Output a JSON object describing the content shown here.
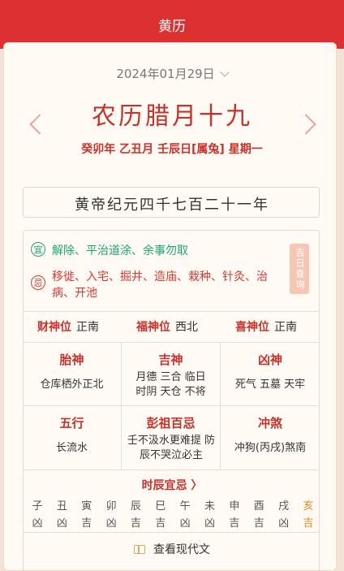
{
  "header": {
    "title": "黄历"
  },
  "date": {
    "selected": "2024年01月29日"
  },
  "lunar": {
    "date": "农历腊月十九",
    "ganzhi": "癸卯年 乙丑月 壬辰日[属兔] 星期一"
  },
  "era": "黄帝纪元四千七百二十一年",
  "yiji": {
    "yi_label": "宜",
    "yi": "解除、平治道涂、余事勿取",
    "ji_label": "忌",
    "ji": "移徙、入宅、掘井、造庙、栽种、针灸、治病、开池",
    "jiri_button": "吉日查询"
  },
  "directions": [
    {
      "label": "财神位",
      "value": "正南"
    },
    {
      "label": "福神位",
      "value": "西北"
    },
    {
      "label": "喜神位",
      "value": "正南"
    }
  ],
  "grid": [
    {
      "title": "胎神",
      "value": "仓库栖外正北"
    },
    {
      "title": "吉神",
      "value": "月德 三合 临日 时阴 天仓 不将"
    },
    {
      "title": "凶神",
      "value": "死气 五墓 天牢"
    },
    {
      "title": "五行",
      "value": "长流水"
    },
    {
      "title": "彭祖百忌",
      "value": "壬不汲水更难提 防 辰不哭泣必主"
    },
    {
      "title": "冲煞",
      "value": "冲狗(丙戌)煞南"
    }
  ],
  "shichen": {
    "title": "时辰宜忌 〉",
    "branches": [
      "子",
      "丑",
      "寅",
      "卯",
      "辰",
      "巳",
      "午",
      "未",
      "申",
      "酉",
      "戌",
      "亥"
    ],
    "luck": [
      "凶",
      "凶",
      "吉",
      "凶",
      "吉",
      "吉",
      "凶",
      "凶",
      "吉",
      "吉",
      "凶",
      "吉"
    ],
    "highlight_index": 11
  },
  "footer": {
    "modern_label": "查看现代文"
  },
  "colors": {
    "brand_red": "#dd3131",
    "text_red": "#c7322d",
    "yi_green": "#19a86e",
    "highlight_orange": "#e08a1e"
  }
}
